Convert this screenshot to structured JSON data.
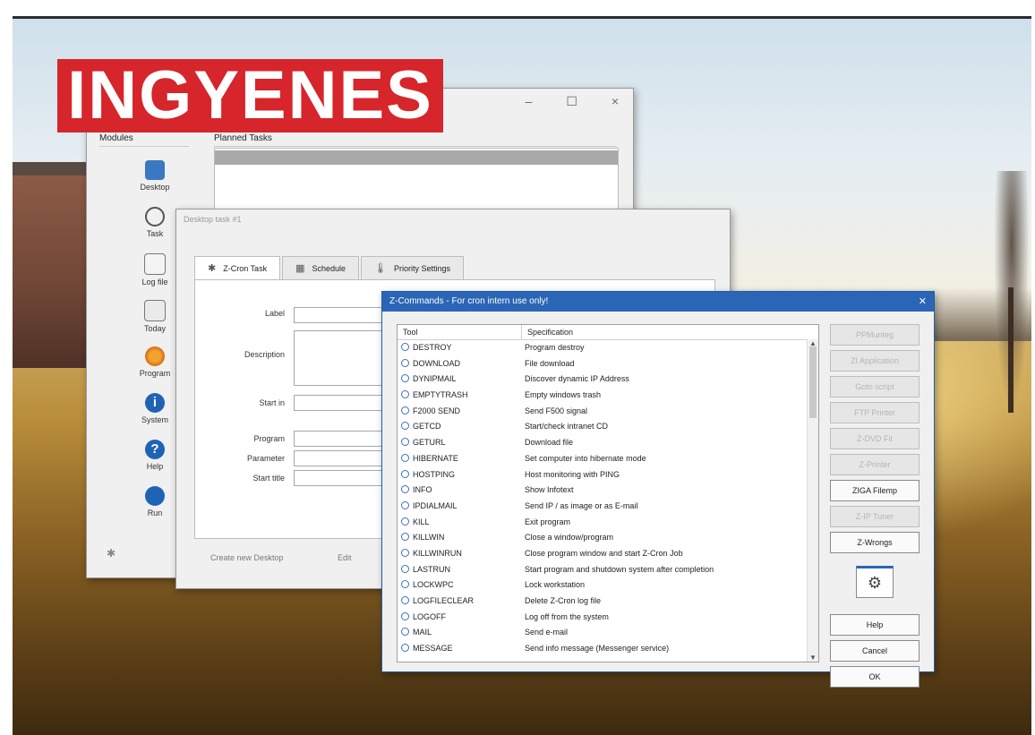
{
  "badge": {
    "text": "INGYENES"
  },
  "main_window": {
    "controls": [
      "–",
      "☐",
      "×"
    ],
    "sidebar_header": "Modules",
    "list_header": "Planned Tasks",
    "sidebar": [
      {
        "label": "Desktop",
        "icon": "desktop-icon"
      },
      {
        "label": "Task",
        "icon": "clock-icon"
      },
      {
        "label": "Log file",
        "icon": "log-file-icon"
      },
      {
        "label": "Today",
        "icon": "calendar-icon"
      },
      {
        "label": "Program",
        "icon": "program-icon"
      },
      {
        "label": "System",
        "icon": "info-icon"
      },
      {
        "label": "Help",
        "icon": "help-icon"
      },
      {
        "label": "Run",
        "icon": "run-icon"
      }
    ]
  },
  "task_window": {
    "title": "Desktop task #1",
    "tabs": [
      "Z-Cron Task",
      "Schedule",
      "Priority Settings"
    ],
    "form": {
      "label": "Label",
      "description": "Description",
      "start_in": "Start in",
      "program": "Program",
      "parameter": "Parameter",
      "start_title": "Start title"
    },
    "footer": {
      "create": "Create new Desktop",
      "edit": "Edit"
    }
  },
  "command_dialog": {
    "title": "Z-Commands - For cron intern use only!",
    "columns": [
      "Tool",
      "Specification"
    ],
    "rows": [
      {
        "tool": "DESTROY",
        "spec": "Program destroy"
      },
      {
        "tool": "DOWNLOAD",
        "spec": "File download"
      },
      {
        "tool": "DYNIPMAIL",
        "spec": "Discover dynamic IP Address"
      },
      {
        "tool": "EMPTYTRASH",
        "spec": "Empty windows trash"
      },
      {
        "tool": "F2000 SEND",
        "spec": "Send F500 signal"
      },
      {
        "tool": "GETCD",
        "spec": "Start/check intranet CD"
      },
      {
        "tool": "GETURL",
        "spec": "Download file"
      },
      {
        "tool": "HIBERNATE",
        "spec": "Set computer into hibernate mode"
      },
      {
        "tool": "HOSTPING",
        "spec": "Host monitoring with PING"
      },
      {
        "tool": "INFO",
        "spec": "Show Infotext"
      },
      {
        "tool": "IPDIALMAIL",
        "spec": "Send IP / as image or as E-mail"
      },
      {
        "tool": "KILL",
        "spec": "Exit program"
      },
      {
        "tool": "KILLWIN",
        "spec": "Close a window/program"
      },
      {
        "tool": "KILLWINRUN",
        "spec": "Close program window and start Z-Cron Job"
      },
      {
        "tool": "LASTRUN",
        "spec": "Start program and shutdown system after completion"
      },
      {
        "tool": "LOCKWPC",
        "spec": "Lock workstation"
      },
      {
        "tool": "LOGFILECLEAR",
        "spec": "Delete Z-Cron log file"
      },
      {
        "tool": "LOGOFF",
        "spec": "Log off from the system"
      },
      {
        "tool": "MAIL",
        "spec": "Send e-mail"
      },
      {
        "tool": "MESSAGE",
        "spec": "Send info message (Messenger service)"
      }
    ],
    "side_buttons": [
      {
        "label": "PPMunteg",
        "enabled": false
      },
      {
        "label": "ZI Application",
        "enabled": false
      },
      {
        "label": "Goto script",
        "enabled": false
      },
      {
        "label": "FTP Printer",
        "enabled": false
      },
      {
        "label": "Z-DVD Fit",
        "enabled": false
      },
      {
        "label": "Z-Printer",
        "enabled": false
      },
      {
        "label": "ZIGA Filemp",
        "enabled": true
      },
      {
        "label": "Z-IP Tuner",
        "enabled": false
      },
      {
        "label": "Z-Wrongs",
        "enabled": true
      }
    ],
    "buttons": {
      "help": "Help",
      "cancel": "Cancel",
      "ok": "OK"
    }
  }
}
